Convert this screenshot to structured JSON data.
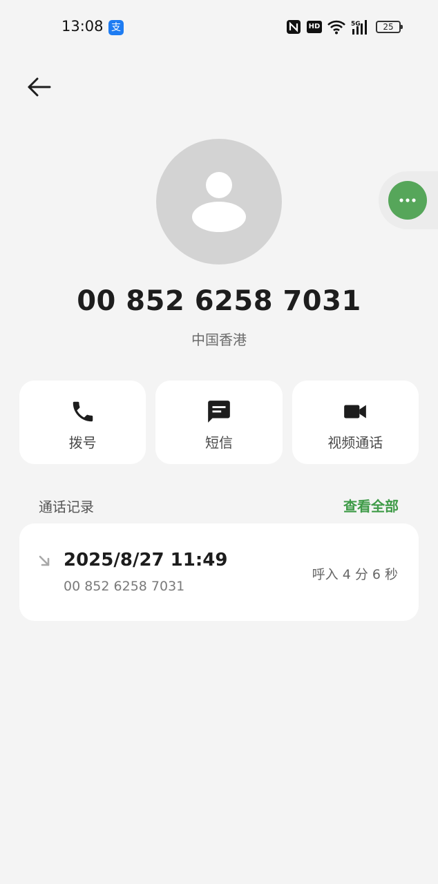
{
  "status_bar": {
    "time": "13:08",
    "app_icon_glyph": "支",
    "battery": "25",
    "hd": "HD",
    "signal": "5G"
  },
  "contact": {
    "number": "00 852 6258 7031",
    "location": "中国香港"
  },
  "actions": [
    {
      "label": "拨号",
      "icon": "phone-icon"
    },
    {
      "label": "短信",
      "icon": "message-icon"
    },
    {
      "label": "视频通话",
      "icon": "video-camera-icon"
    }
  ],
  "history": {
    "title": "通话记录",
    "view_all": "查看全部",
    "records": [
      {
        "datetime": "2025/8/27 11:49",
        "number": "00 852 6258 7031",
        "duration": "呼入  4 分 6 秒"
      }
    ]
  },
  "colors": {
    "accent_green": "#3f9b48",
    "float_green": "#56a65a",
    "background": "#f4f4f4",
    "avatar_gray": "#d3d3d3"
  }
}
